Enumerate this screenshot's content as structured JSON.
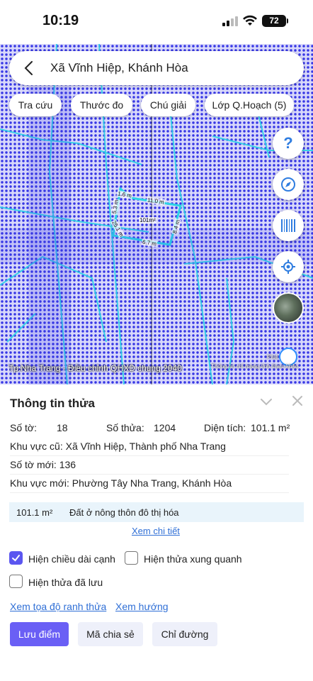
{
  "status_bar": {
    "time": "10:19",
    "battery": "72"
  },
  "search": {
    "location": "Xã Vĩnh Hiệp, Khánh Hòa"
  },
  "chips": [
    "Tra cứu",
    "Thước đo",
    "Chú giải",
    "Lớp Q.Hoạch (5)"
  ],
  "map": {
    "caption": "Tp.Nha Trang - Điều chỉnh QHXD chung 2040",
    "attribution": "Thông tin chỉ mang tính tham khảo",
    "attribution_top": "Phiê",
    "attribution_top_suffix": "2",
    "parcel_labels": [
      "1.6 m",
      "11.0 m",
      "5.3 m",
      "101m²",
      "25.1 m",
      "8.4 m",
      "6.7 m"
    ],
    "fab_icons": [
      "help-icon",
      "compass-icon",
      "barcode-icon",
      "locate-icon",
      "satellite-thumbnail"
    ],
    "fab_help": "?"
  },
  "panel": {
    "title": "Thông tin thửa",
    "so_to_label": "Số tờ:",
    "so_to_value": "18",
    "so_thua_label": "Số thửa:",
    "so_thua_value": "1204",
    "dien_tich_label": "Diện tích:",
    "dien_tich_value": "101.1 m²",
    "khu_vuc_cu": "Khu vực cũ: Xã Vĩnh Hiệp, Thành phố Nha Trang",
    "so_to_moi": "Số tờ mới: 136",
    "khu_vuc_moi": "Khu vực mới: Phường Tây Nha Trang, Khánh Hòa",
    "land_area": "101.1 m²",
    "land_type": "Đất ở nông thôn đô thị hóa",
    "details_link": "Xem chi tiết",
    "checkbox_edge_length": "Hiện chiều dài cạnh",
    "checkbox_edge_length_checked": true,
    "checkbox_neighbors": "Hiện thửa xung quanh",
    "checkbox_neighbors_checked": false,
    "checkbox_saved": "Hiện thửa đã lưu",
    "checkbox_saved_checked": false,
    "coords_link": "Xem tọa độ ranh thửa",
    "direction_link": "Xem hướng",
    "save_button": "Lưu điểm",
    "share_button": "Mã chia sẻ",
    "route_button": "Chỉ đường"
  }
}
